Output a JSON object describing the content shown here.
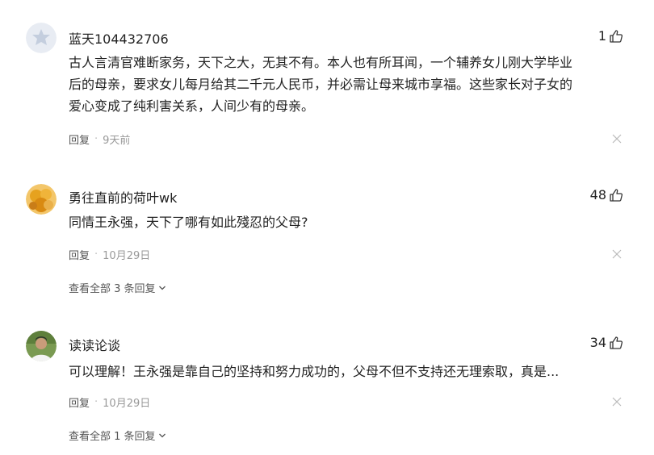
{
  "comments": [
    {
      "author": "蓝天104432706",
      "likes": "1",
      "avatar": "default-avatar-icon",
      "lines": [
        "古人言清官难断家务，天下之大，无其不有。本人也有所耳闻，一个辅养女儿刚大学毕业",
        "后的母亲，要求女儿每月给其二千元人民币，并必需让母来城市享福。这些家长对子女的",
        "爱心变成了纯利害关系，人间少有的母亲。"
      ],
      "reply_label": "回复",
      "time": "9天前"
    },
    {
      "author": "勇往直前的荷叶wk",
      "likes": "48",
      "avatar": "flower-avatar",
      "lines": [
        "同情王永强，天下了哪有如此殘忍的父母?"
      ],
      "reply_label": "回复",
      "time": "10月29日",
      "more_replies": "查看全部 3 条回复"
    },
    {
      "author": "读读论谈",
      "likes": "34",
      "avatar": "person-avatar",
      "lines": [
        "可以理解！王永强是靠自己的坚持和努力成功的，父母不但不支持还无理索取，真是..."
      ],
      "reply_label": "回复",
      "time": "10月29日",
      "more_replies": "查看全部 1 条回复"
    }
  ],
  "colors": {
    "text": "#222222",
    "meta": "#999999",
    "reply": "#555555"
  }
}
